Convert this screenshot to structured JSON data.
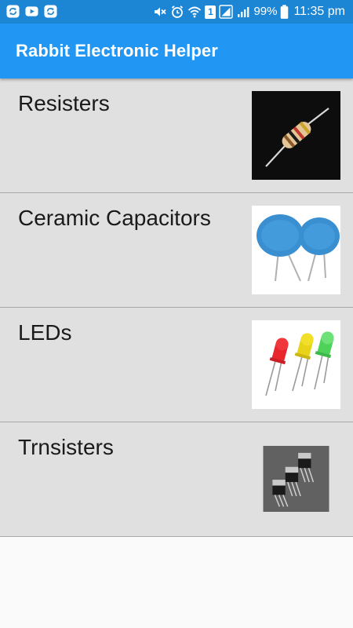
{
  "status_bar": {
    "battery_percent": "99%",
    "time": "11:35 pm",
    "sim_badge": "1",
    "notification_icons": [
      "sync-icon",
      "youtube-icon",
      "sync-icon"
    ],
    "system_icons": [
      "mute-icon",
      "alarm-icon",
      "wifi-icon",
      "sim-icon",
      "signal-icon",
      "signal-icon",
      "battery-icon"
    ]
  },
  "app_bar": {
    "title": "Rabbit Electronic Helper",
    "color": "#2196f3"
  },
  "list": {
    "items": [
      {
        "label": "Resisters",
        "image": "resistor-image"
      },
      {
        "label": "Ceramic Capacitors",
        "image": "ceramic-capacitor-image"
      },
      {
        "label": "LEDs",
        "image": "led-image"
      },
      {
        "label": "Trnsisters",
        "image": "transistor-image"
      }
    ]
  }
}
